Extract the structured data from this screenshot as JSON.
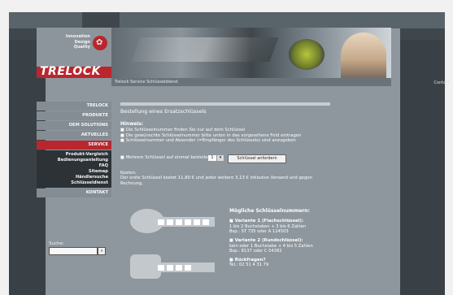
{
  "header": {
    "brand": "TRELOCK",
    "tagline": [
      "Innovation",
      "Design",
      "Quality"
    ],
    "contact_link": "Contact",
    "breadcrumb": "Trelock Service Schlüsseldienst"
  },
  "nav": {
    "items": [
      "TRELOCK",
      "PRODUKTE",
      "OEM SOLUTIONS",
      "AKTUELLES",
      "SERVICE"
    ],
    "sub_items": [
      "Produkt-Vergleich",
      "Bedienungsanleitung",
      "FAQ",
      "Sitemap",
      "Händlersuche",
      "Schlüsseldienst"
    ],
    "after": "KONTAKT"
  },
  "search": {
    "label": "Suche:",
    "button": "»"
  },
  "main": {
    "title": "Bestellung eines Ersatzschlüssels",
    "hint_label": "Hinweis:",
    "hints": [
      "Die Schlüsselnummer finden Sie nur auf dem Schlüssel",
      "Die gewünschte Schlüsselnummer bitte unten in das vorgesehene Feld eintragen",
      "Schlüsselnummer und Absender (=Empfänger des Schlüssels) sind anzugeben"
    ],
    "order_text": "Mehrere Schlüssel auf einmal bestellen:",
    "qty_value": "1",
    "qty_dd": "▾",
    "order_button": "Schlüssel anfordern",
    "costs_label": "Kosten:",
    "costs_lines": [
      "Der erste Schlüssel kostet 11,80 € und jeder weitere 3,13 € inklusive Versand und gegen",
      "Rechnung."
    ]
  },
  "numbers": {
    "heading": "Mögliche Schlüsselnummern:",
    "variants": [
      {
        "title": "Variante 1 (Flachschlüssel):",
        "desc": "1 bis 2 Buchstaben + 3 bis 6 Zahlen",
        "example": "Bsp.: ST 735 oder A 124503"
      },
      {
        "title": "Variante 2 (Rundschlüssel):",
        "desc": "kein oder 1 Buchstabe + 4 bis 5 Zahlen",
        "example": "Bsp.: 8137 oder C 04382"
      },
      {
        "title": "Rückfragen?",
        "desc": "Tel.: 02 51 4 31 79",
        "example": ""
      }
    ]
  },
  "colors": {
    "accent": "#b9262d",
    "background": "#3a4146"
  }
}
